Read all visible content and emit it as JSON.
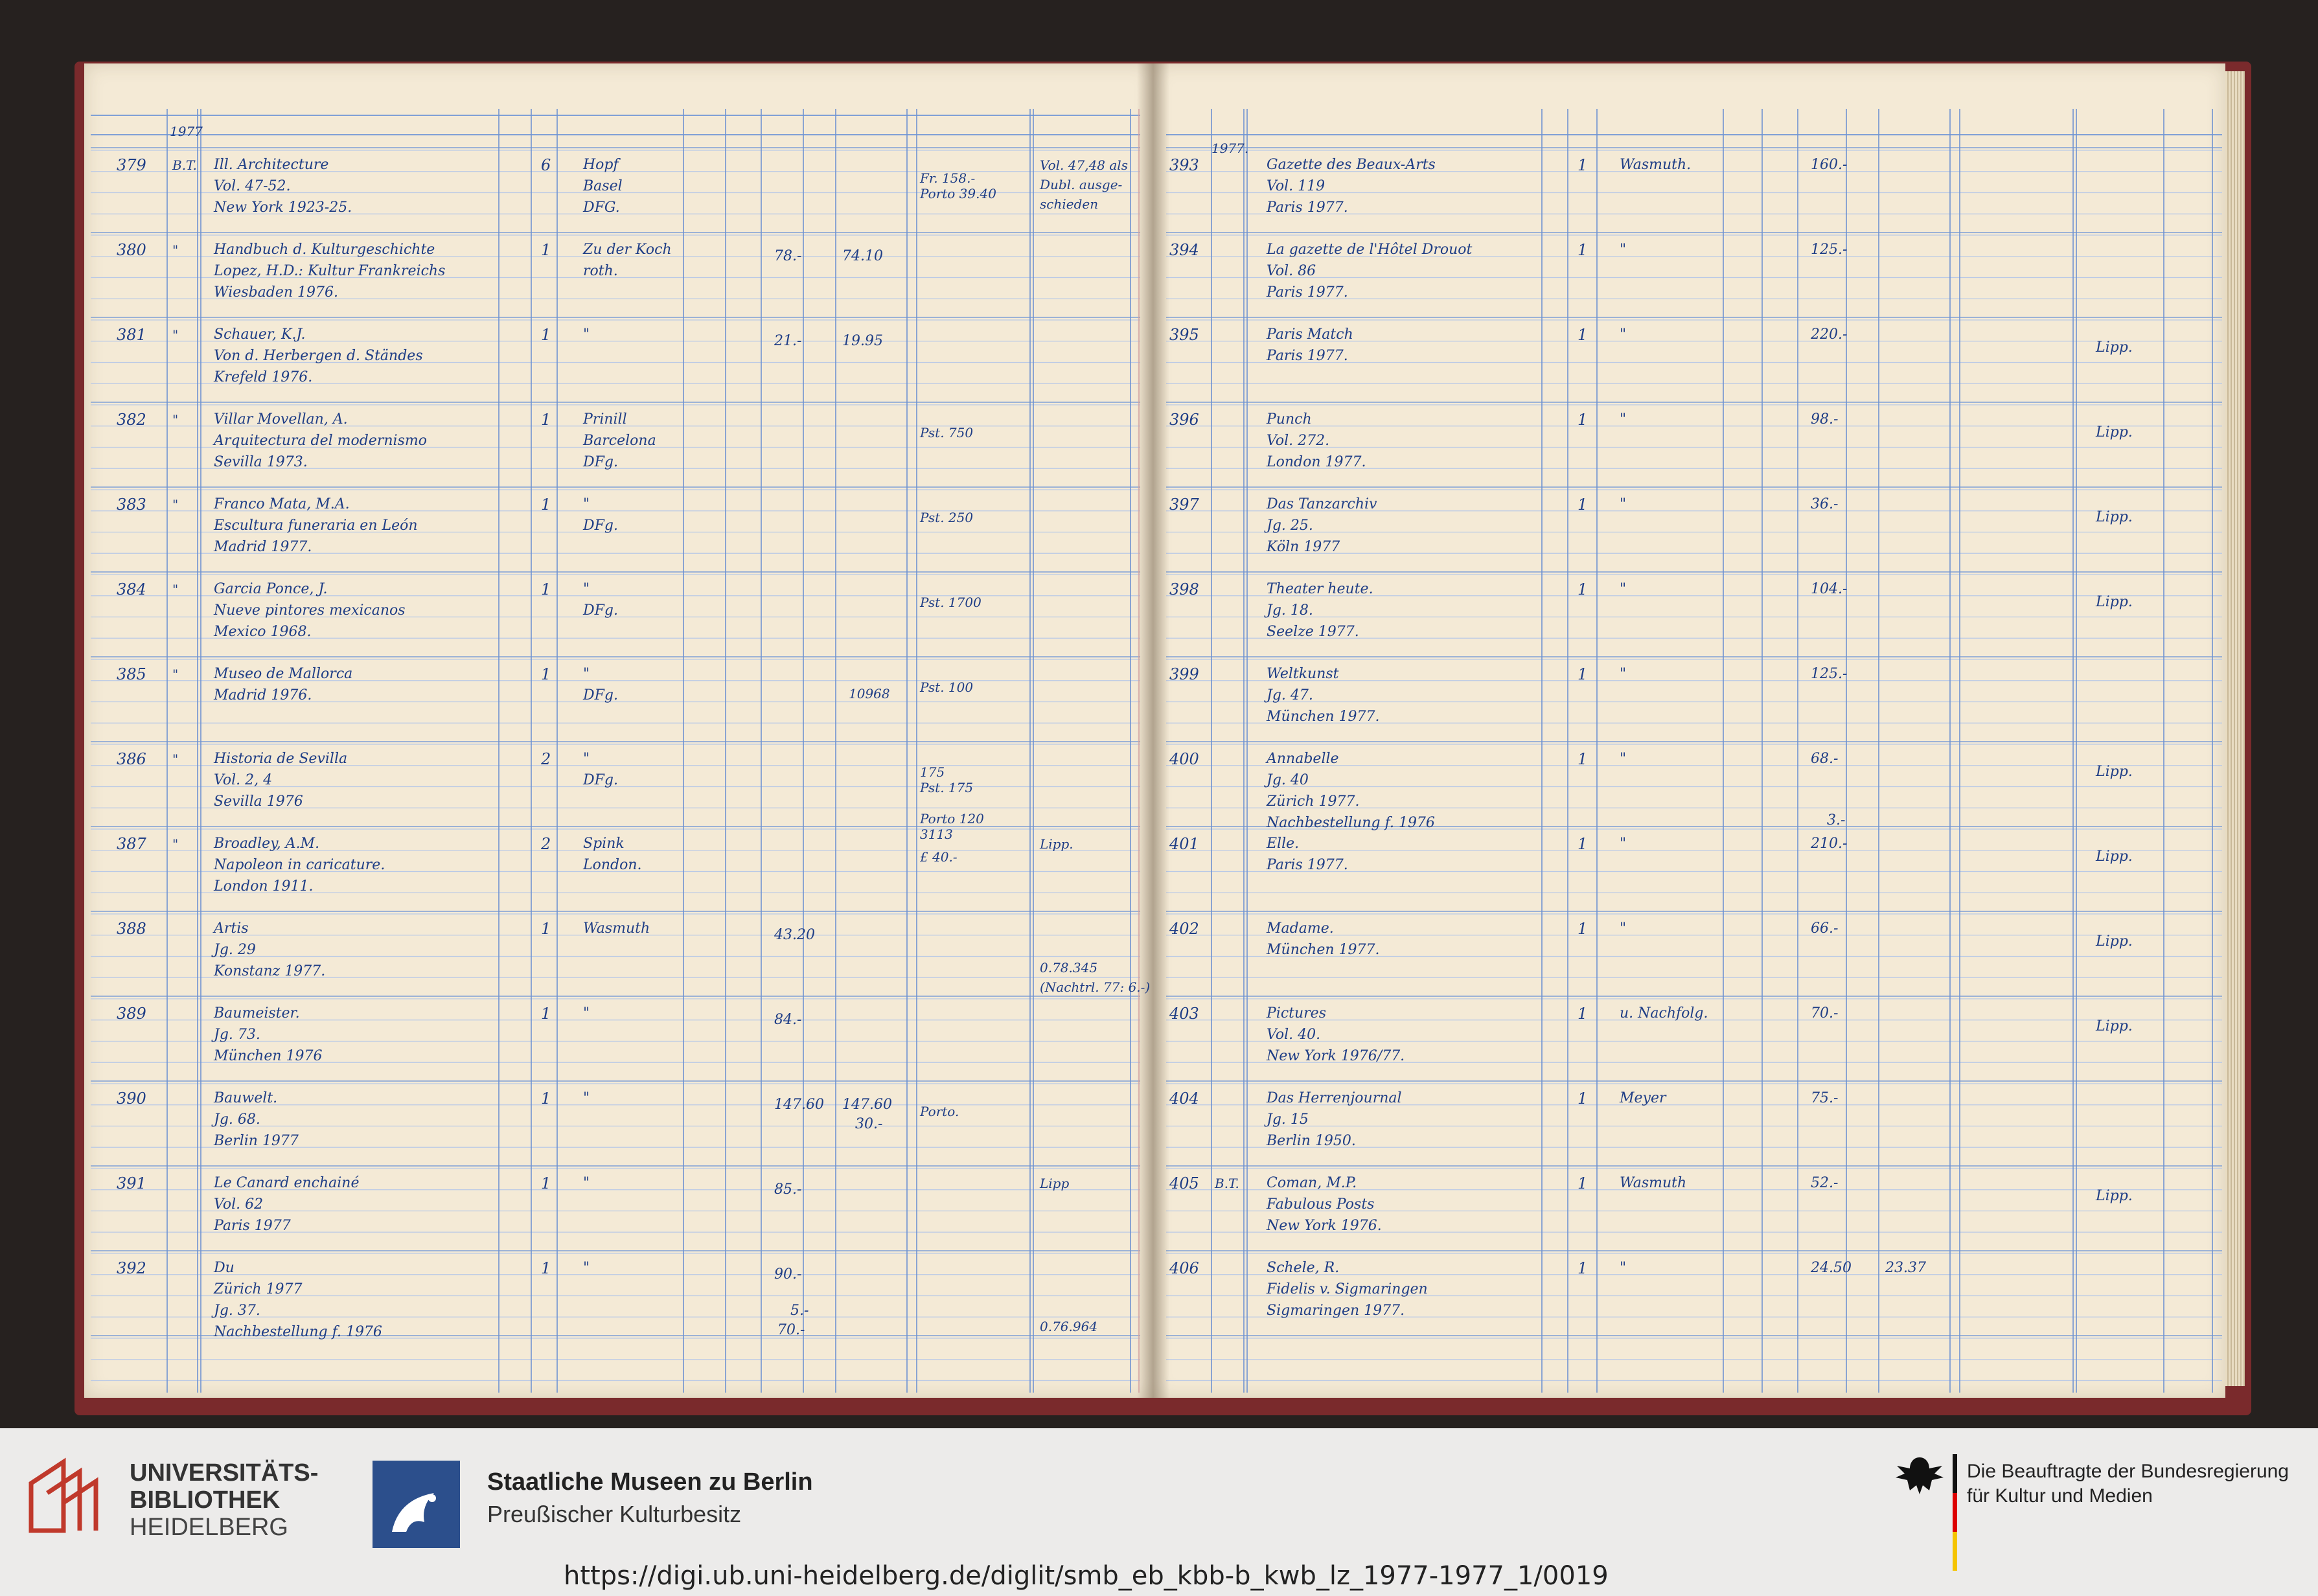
{
  "ledger": {
    "left": {
      "year_head": "1977",
      "rows": [
        {
          "nr": "379",
          "code": "B.T.",
          "title": [
            "Ill. Architecture",
            "Vol. 47-52.",
            "New York 1923-25."
          ],
          "qty": "6",
          "dealer": [
            "Hopf",
            "Basel",
            "DFG."
          ],
          "price": "",
          "paid": "",
          "note": [
            "Fr. 158.-",
            "Porto 39.40"
          ],
          "remark": [
            "Vol. 47,48 als",
            "Dubl. ausge-",
            "schieden"
          ]
        },
        {
          "nr": "380",
          "code": "\"",
          "title": [
            "Handbuch d. Kulturgeschichte",
            "Lopez, H.D.: Kultur Frankreichs",
            "Wiesbaden 1976."
          ],
          "qty": "1",
          "dealer": [
            "Zu der Koch",
            "roth."
          ],
          "price": "78.-",
          "paid": "74.10",
          "note": [],
          "remark": []
        },
        {
          "nr": "381",
          "code": "\"",
          "title": [
            "Schauer, K.J.",
            "Von d. Herbergen d. Ständes",
            "Krefeld 1976."
          ],
          "qty": "1",
          "dealer": [
            "\""
          ],
          "price": "21.-",
          "paid": "19.95",
          "note": [],
          "remark": []
        },
        {
          "nr": "382",
          "code": "\"",
          "title": [
            "Villar Movellan, A.",
            "Arquitectura del modernismo",
            "Sevilla 1973."
          ],
          "qty": "1",
          "dealer": [
            "Prinill",
            "Barcelona",
            "DFg."
          ],
          "price": "",
          "paid": "",
          "note": [
            "Pst. 750"
          ],
          "remark": []
        },
        {
          "nr": "383",
          "code": "\"",
          "title": [
            "Franco Mata, M.A.",
            "Escultura funeraria en León",
            "Madrid 1977."
          ],
          "qty": "1",
          "dealer": [
            "\"",
            "DFg."
          ],
          "price": "",
          "paid": "",
          "note": [
            "Pst. 250"
          ],
          "remark": []
        },
        {
          "nr": "384",
          "code": "\"",
          "title": [
            "Garcia Ponce, J.",
            "Nueve pintores mexicanos",
            "Mexico 1968."
          ],
          "qty": "1",
          "dealer": [
            "\"",
            "DFg."
          ],
          "price": "",
          "paid": "",
          "note": [
            "Pst. 1700"
          ],
          "remark": []
        },
        {
          "nr": "385",
          "code": "\"",
          "title": [
            "Museo de Mallorca",
            "Madrid 1976."
          ],
          "qty": "1",
          "dealer": [
            "\"",
            "DFg."
          ],
          "price": "",
          "paid": "",
          "sum": "10968",
          "note": [
            "Pst. 100"
          ],
          "remark": []
        },
        {
          "nr": "386",
          "code": "\"",
          "title": [
            "Historia de Sevilla",
            "Vol. 2, 4",
            "Sevilla 1976"
          ],
          "qty": "2",
          "dealer": [
            "\"",
            "DFg."
          ],
          "price": "",
          "paid": "",
          "note": [
            "175",
            "Pst. 175",
            "",
            "Porto 120",
            "3113"
          ],
          "remark": []
        },
        {
          "nr": "387",
          "code": "\"",
          "title": [
            "Broadley, A.M.",
            "Napoleon in caricature.",
            "London 1911."
          ],
          "qty": "2",
          "dealer": [
            "Spink",
            "London."
          ],
          "price": "",
          "paid": "",
          "note": [
            "£ 40.-"
          ],
          "remark": [
            "Lipp."
          ]
        },
        {
          "nr": "388",
          "code": "",
          "title": [
            "Artis",
            "Jg. 29",
            "Konstanz 1977."
          ],
          "qty": "1",
          "dealer": [
            "Wasmuth"
          ],
          "price": "43.20",
          "paid": "",
          "note": [],
          "remark": [
            "",
            "",
            "0.78.345",
            "(Nachtrl. 77: 6.-)"
          ]
        },
        {
          "nr": "389",
          "code": "",
          "title": [
            "Baumeister.",
            "Jg. 73.",
            "München 1976"
          ],
          "qty": "1",
          "dealer": [
            "\""
          ],
          "price": "84.-",
          "paid": "",
          "note": [],
          "remark": []
        },
        {
          "nr": "390",
          "code": "",
          "title": [
            "Bauwelt.",
            "Jg. 68.",
            "Berlin 1977"
          ],
          "qty": "1",
          "dealer": [
            "\""
          ],
          "price": "147.60",
          "paid": "147.60",
          "paid2": "30.-",
          "note": [
            "Porto."
          ],
          "remark": []
        },
        {
          "nr": "391",
          "code": "",
          "title": [
            "Le Canard enchainé",
            "Vol. 62",
            "Paris 1977"
          ],
          "qty": "1",
          "dealer": [
            "\""
          ],
          "price": "85.-",
          "paid": "",
          "note": [],
          "remark": [
            "Lipp"
          ]
        },
        {
          "nr": "392",
          "code": "",
          "title": [
            "Du",
            "Zürich 1977",
            "Jg. 37.",
            "Nachbestellung f. 1976"
          ],
          "qty": "1",
          "dealer": [
            "\""
          ],
          "price": "90.-",
          "price2": "5.-",
          "price3": "70.-",
          "paid": "",
          "note": [],
          "remark": [
            "",
            "",
            "",
            "0.76.964"
          ]
        }
      ]
    },
    "right": {
      "year_head": "1977.",
      "rows": [
        {
          "nr": "393",
          "code": "",
          "title": [
            "Gazette des Beaux-Arts",
            "Vol. 119",
            "Paris 1977."
          ],
          "qty": "1",
          "dealer": [
            "Wasmuth."
          ],
          "price": "160.-",
          "paid": "",
          "remark": ""
        },
        {
          "nr": "394",
          "code": "",
          "title": [
            "La gazette de l'Hôtel Drouot",
            "Vol. 86",
            "Paris 1977."
          ],
          "qty": "1",
          "dealer": [
            "\""
          ],
          "price": "125.-",
          "paid": "",
          "remark": ""
        },
        {
          "nr": "395",
          "code": "",
          "title": [
            "Paris Match",
            "Paris 1977."
          ],
          "qty": "1",
          "dealer": [
            "\""
          ],
          "price": "220.-",
          "paid": "",
          "remark": "Lipp."
        },
        {
          "nr": "396",
          "code": "",
          "title": [
            "Punch",
            "Vol. 272.",
            "London 1977."
          ],
          "qty": "1",
          "dealer": [
            "\""
          ],
          "price": "98.-",
          "paid": "",
          "remark": "Lipp."
        },
        {
          "nr": "397",
          "code": "",
          "title": [
            "Das Tanzarchiv",
            "Jg. 25.",
            "Köln 1977"
          ],
          "qty": "1",
          "dealer": [
            "\""
          ],
          "price": "36.-",
          "paid": "",
          "remark": "Lipp."
        },
        {
          "nr": "398",
          "code": "",
          "title": [
            "Theater heute.",
            "Jg. 18.",
            "Seelze 1977."
          ],
          "qty": "1",
          "dealer": [
            "\""
          ],
          "price": "104.-",
          "paid": "",
          "remark": "Lipp."
        },
        {
          "nr": "399",
          "code": "",
          "title": [
            "Weltkunst",
            "Jg. 47.",
            "München 1977."
          ],
          "qty": "1",
          "dealer": [
            "\""
          ],
          "price": "125.-",
          "paid": "",
          "remark": ""
        },
        {
          "nr": "400",
          "code": "",
          "title": [
            "Annabelle",
            "Jg. 40",
            "Zürich 1977.",
            "Nachbestellung f. 1976"
          ],
          "qty": "1",
          "dealer": [
            "\""
          ],
          "price": "68.-",
          "price2": "3.-",
          "paid": "",
          "remark": "Lipp."
        },
        {
          "nr": "401",
          "code": "",
          "title": [
            "Elle.",
            "Paris 1977."
          ],
          "qty": "1",
          "dealer": [
            "\""
          ],
          "price": "210.-",
          "paid": "",
          "remark": "Lipp."
        },
        {
          "nr": "402",
          "code": "",
          "title": [
            "Madame.",
            "München 1977."
          ],
          "qty": "1",
          "dealer": [
            "\""
          ],
          "price": "66.-",
          "paid": "",
          "remark": "Lipp."
        },
        {
          "nr": "403",
          "code": "",
          "title": [
            "Pictures",
            "Vol. 40.",
            "New York 1976/77."
          ],
          "qty": "1",
          "dealer": [
            "u. Nachfolg."
          ],
          "price": "70.-",
          "paid": "",
          "remark": "Lipp."
        },
        {
          "nr": "404",
          "code": "",
          "title": [
            "Das Herrenjournal",
            "Jg. 15",
            "Berlin 1950."
          ],
          "qty": "1",
          "dealer": [
            "Meyer"
          ],
          "price": "75.-",
          "paid": "",
          "remark": ""
        },
        {
          "nr": "405",
          "code": "B.T.",
          "title": [
            "Coman, M.P.",
            "Fabulous Posts",
            "New York 1976."
          ],
          "qty": "1",
          "dealer": [
            "Wasmuth"
          ],
          "price": "52.-",
          "paid": "",
          "remark": "Lipp."
        },
        {
          "nr": "406",
          "code": "",
          "title": [
            "Schele, R.",
            "Fidelis v. Sigmaringen",
            "Sigmaringen 1977."
          ],
          "qty": "1",
          "dealer": [
            "\""
          ],
          "price": "24.50",
          "paid": "23.37",
          "remark": ""
        }
      ]
    }
  },
  "footer": {
    "ub_logo": {
      "line1": "UNIVERSITÄTS-",
      "line2": "BIBLIOTHEK",
      "line3": "HEIDELBERG",
      "icon": "ub-heidelberg-logo-icon",
      "color": "#c0392b"
    },
    "smb_logo": {
      "line1": "Staatliche Museen zu Berlin",
      "line2": "Preußischer Kulturbesitz",
      "icon": "smb-eagle-logo-icon",
      "color": "#2c4f8c"
    },
    "bkm_logo": {
      "line1": "Die Beauftragte der Bundesregierung",
      "line2": "für Kultur und Medien",
      "icon": "federal-eagle-icon"
    },
    "url": "https://digi.ub.uni-heidelberg.de/diglit/smb_eb_kbb-b_kwb_lz_1977-1977_1/0019"
  }
}
